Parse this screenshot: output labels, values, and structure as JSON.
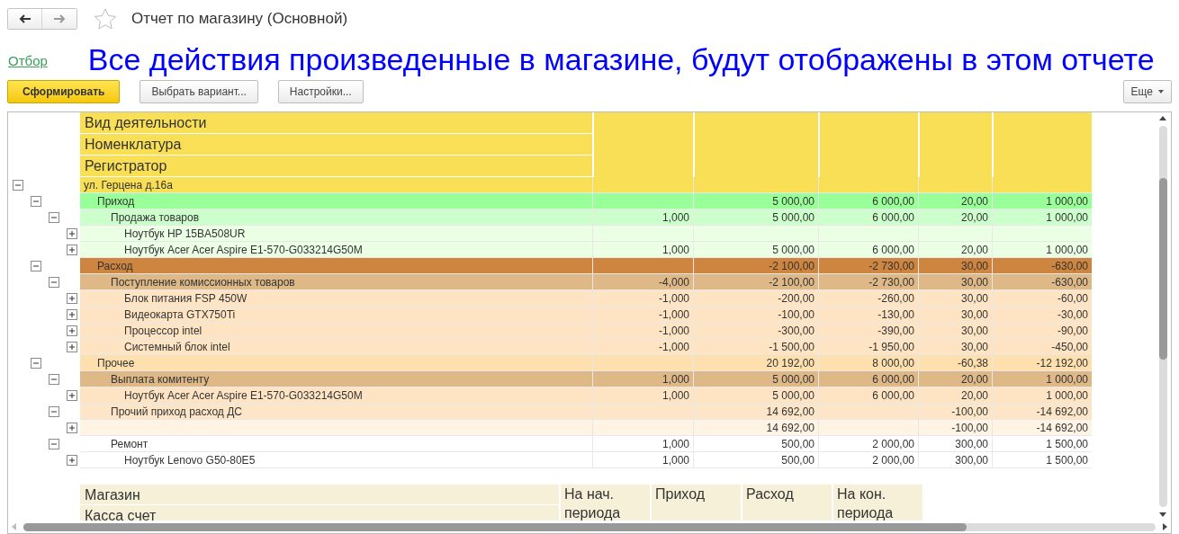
{
  "window": {
    "title": "Отчет по магазину (Основной)",
    "favorite": false
  },
  "filter_link": "Отбор",
  "banner": "Все действия произведенные в магазине, будут отображены в этом отчете",
  "toolbar": {
    "buttons": [
      {
        "label": "Сформировать",
        "kind": "primary"
      },
      {
        "label": "Выбрать вариант...",
        "kind": "default"
      },
      {
        "label": "Настройки...",
        "kind": "default"
      }
    ],
    "more": "Еще"
  },
  "report": {
    "header_rows": [
      "Вид деятельности",
      "Номенклатура",
      "Регистратор"
    ],
    "rows": [
      {
        "label": "ул. Герцена д.16а",
        "color": "#f9df55",
        "expanded": true,
        "children": [
          {
            "label": "Приход",
            "color": "#99ff99",
            "expanded": true,
            "cells": {
              "col_2": "5 000,00",
              "col_3": "6 000,00",
              "col_4": "20,00",
              "col_5": "1 000,00"
            },
            "children": [
              {
                "label": "Продажа товаров",
                "color": "#ccffcc",
                "expanded": true,
                "cells": {
                  "col_1": "1,000",
                  "col_2": "5 000,00",
                  "col_3": "6 000,00",
                  "col_4": "20,00",
                  "col_5": "1 000,00"
                },
                "children": [
                  {
                    "label": "Ноутбук HP 15BA508UR",
                    "color": "#eaffe4",
                    "expanded": false
                  },
                  {
                    "label": "Ноутбук Acer Acer Aspire E1-570-G033214G50M",
                    "color": "#eaffe4",
                    "expanded": false,
                    "cells": {
                      "col_1": "1,000",
                      "col_2": "5 000,00",
                      "col_3": "6 000,00",
                      "col_4": "20,00",
                      "col_5": "1 000,00"
                    }
                  }
                ]
              }
            ]
          },
          {
            "label": "Расход",
            "color": "#cd853f",
            "expanded": true,
            "cells": {
              "col_2": "-2 100,00",
              "col_3": "-2 730,00",
              "col_4": "30,00",
              "col_5": "-630,00"
            },
            "children": [
              {
                "label": "Поступление комиссионных товаров",
                "color": "#deb887",
                "expanded": true,
                "cells": {
                  "col_1": "-4,000",
                  "col_2": "-2 100,00",
                  "col_3": "-2 730,00",
                  "col_4": "30,00",
                  "col_5": "-630,00"
                },
                "children": [
                  {
                    "label": "Блок питания FSP 450W",
                    "color": "#ffe4c4",
                    "expanded": false,
                    "cells": {
                      "col_1": "-1,000",
                      "col_2": "-200,00",
                      "col_3": "-260,00",
                      "col_4": "30,00",
                      "col_5": "-60,00"
                    }
                  },
                  {
                    "label": "Видеокарта GTX750Ti",
                    "color": "#ffe4c4",
                    "expanded": false,
                    "cells": {
                      "col_1": "-1,000",
                      "col_2": "-100,00",
                      "col_3": "-130,00",
                      "col_4": "30,00",
                      "col_5": "-30,00"
                    }
                  },
                  {
                    "label": "Процессор intel",
                    "color": "#ffe4c4",
                    "expanded": false,
                    "cells": {
                      "col_1": "-1,000",
                      "col_2": "-300,00",
                      "col_3": "-390,00",
                      "col_4": "30,00",
                      "col_5": "-90,00"
                    }
                  },
                  {
                    "label": "Системный блок intel",
                    "color": "#ffe4c4",
                    "expanded": false,
                    "cells": {
                      "col_1": "-1,000",
                      "col_2": "-1 500,00",
                      "col_3": "-1 950,00",
                      "col_4": "30,00",
                      "col_5": "-450,00"
                    }
                  }
                ]
              }
            ]
          },
          {
            "label": "Прочее",
            "color": "#fde0ae",
            "expanded": true,
            "cells": {
              "col_2": "20 192,00",
              "col_3": "8 000,00",
              "col_4": "-60,38",
              "col_5": "-12 192,00"
            },
            "children": [
              {
                "label": "Выплата комитенту",
                "color": "#deb887",
                "expanded": true,
                "cells": {
                  "col_1": "1,000",
                  "col_2": "5 000,00",
                  "col_3": "6 000,00",
                  "col_4": "20,00",
                  "col_5": "1 000,00"
                },
                "children": [
                  {
                    "label": "Ноутбук Acer Acer Aspire E1-570-G033214G50M",
                    "color": "#ffe4c4",
                    "expanded": false,
                    "cells": {
                      "col_1": "1,000",
                      "col_2": "5 000,00",
                      "col_3": "6 000,00",
                      "col_4": "20,00",
                      "col_5": "1 000,00"
                    }
                  }
                ]
              },
              {
                "label": "Прочий приход расход ДС",
                "color": "#fde6c8",
                "expanded": true,
                "cells": {
                  "col_2": "14 692,00",
                  "col_4": "-100,00",
                  "col_5": "-14 692,00"
                },
                "children": [
                  {
                    "color": "#fff3e3",
                    "expanded": false,
                    "cells": {
                      "col_2": "14 692,00",
                      "col_4": "-100,00",
                      "col_5": "-14 692,00"
                    }
                  }
                ]
              },
              {
                "label": "Ремонт",
                "color": "#ffffff",
                "expanded": true,
                "cells": {
                  "col_1": "1,000",
                  "col_2": "500,00",
                  "col_3": "2 000,00",
                  "col_4": "300,00",
                  "col_5": "1 500,00"
                },
                "children": [
                  {
                    "label": "Ноутбук Lenovo G50-80E5",
                    "color": "#ffffff",
                    "expanded": false,
                    "cells": {
                      "col_1": "1,000",
                      "col_2": "500,00",
                      "col_3": "2 000,00",
                      "col_4": "300,00",
                      "col_5": "1 500,00"
                    }
                  }
                ]
              }
            ]
          }
        ]
      }
    ],
    "footer_table": {
      "row_labels": [
        "Магазин",
        "Касса счет"
      ],
      "columns": [
        "На нач. периода",
        "Приход",
        "Расход",
        "На кон. периода"
      ]
    }
  }
}
